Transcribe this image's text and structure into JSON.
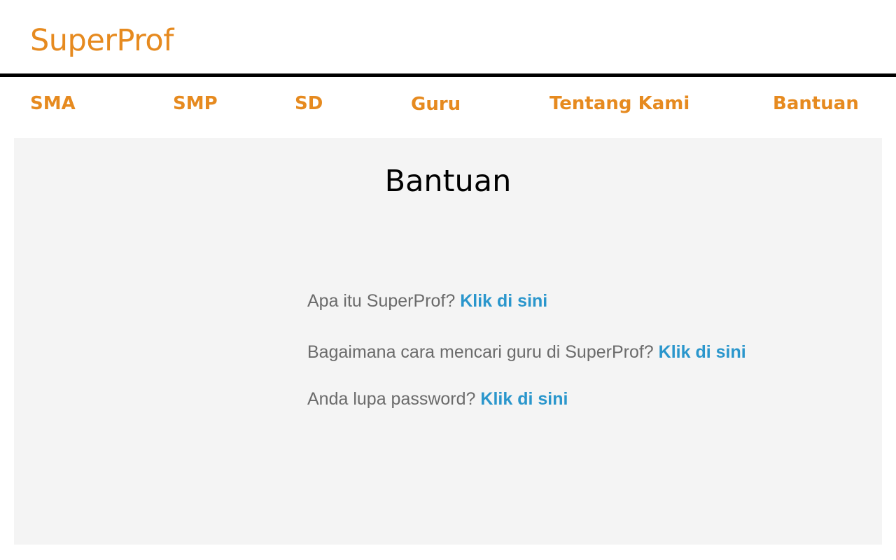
{
  "header": {
    "logo_text": "SuperProf",
    "brand_color": "#e68a1f"
  },
  "nav": {
    "items": [
      {
        "label": "SMA"
      },
      {
        "label": "SMP"
      },
      {
        "label": "SD"
      },
      {
        "label": "Guru"
      },
      {
        "label": "Tentang Kami"
      },
      {
        "label": "Bantuan"
      }
    ]
  },
  "main": {
    "title": "Bantuan",
    "background_color": "#f4f4f4",
    "faq": [
      {
        "question": "Apa itu SuperProf?",
        "link_label": "Klik di sini"
      },
      {
        "question": "Bagaimana cara mencari guru di SuperProf?",
        "link_label": "Klik di sini"
      },
      {
        "question": "Anda lupa password?",
        "link_label": "Klik di sini"
      }
    ],
    "link_color": "#2a96cc"
  }
}
